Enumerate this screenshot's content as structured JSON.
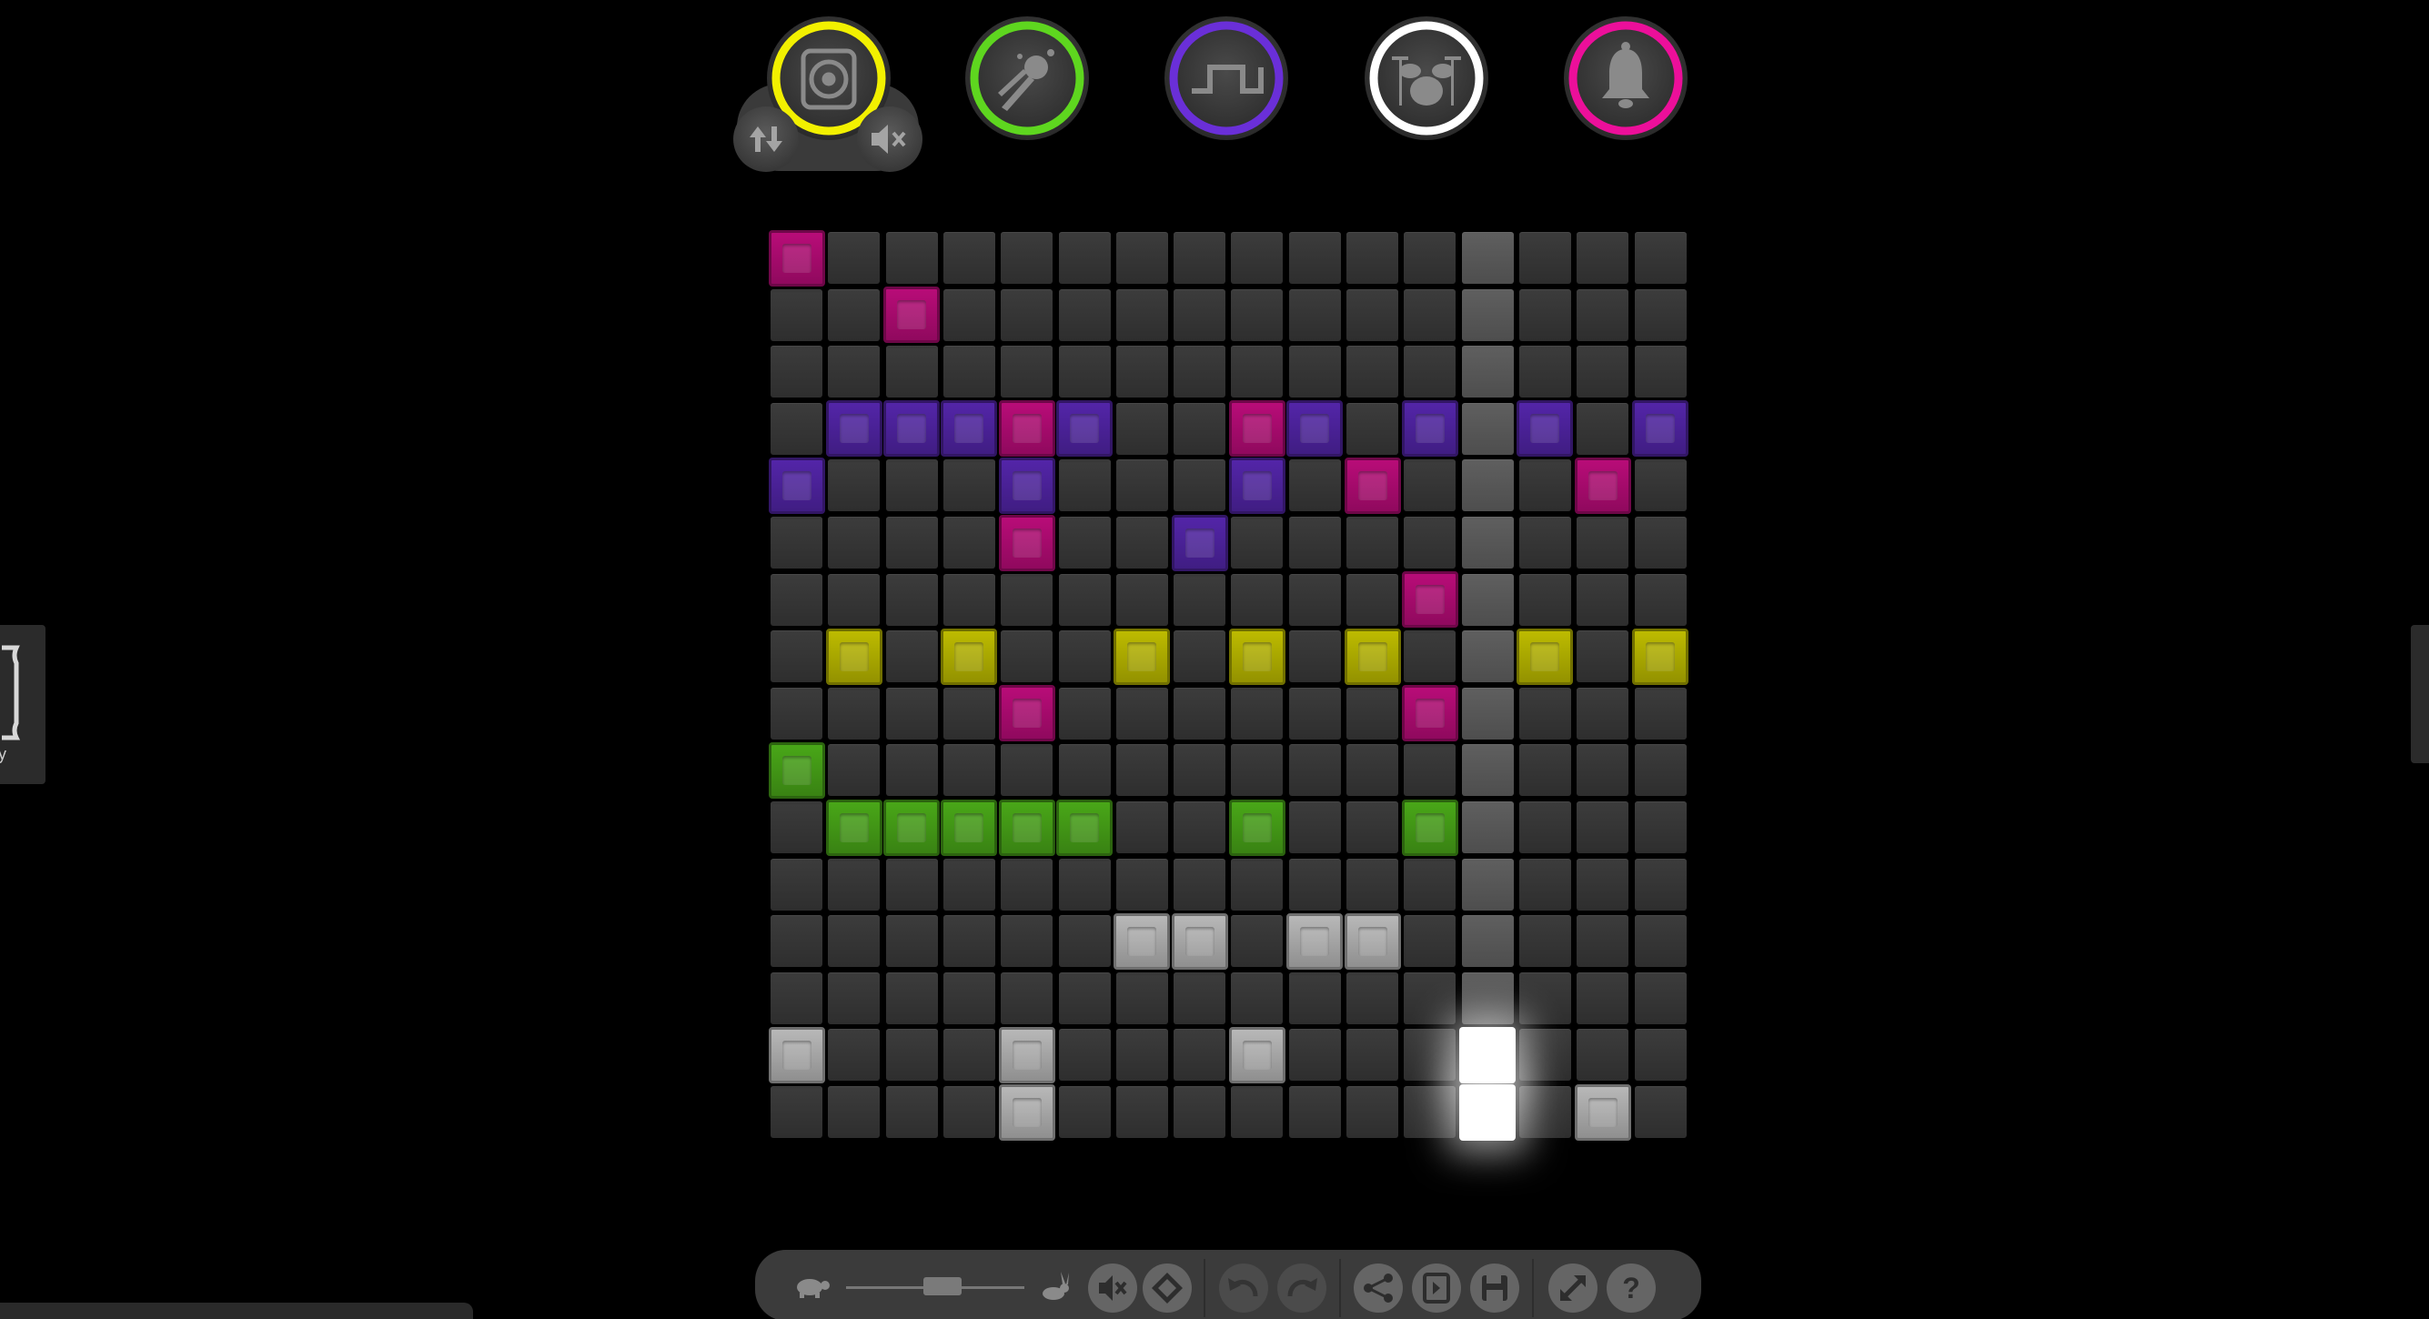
{
  "side_panel_left": {
    "label": "y",
    "icon": "frame-icon"
  },
  "instruments": [
    {
      "name": "speaker",
      "icon": "speaker-icon",
      "color": "#f2f000",
      "selected": true
    },
    {
      "name": "synth-lead",
      "icon": "comet-icon",
      "color": "#5ed61f"
    },
    {
      "name": "square-wave",
      "icon": "square-wave-icon",
      "color": "#6a2fd8"
    },
    {
      "name": "drums",
      "icon": "drum-kit-icon",
      "color": "#ffffff"
    },
    {
      "name": "bell",
      "icon": "bell-icon",
      "color": "#ec0f9a"
    }
  ],
  "instrument_tools": [
    {
      "name": "octave-toggle",
      "icon": "up-down-arrows-icon"
    },
    {
      "name": "mute-instrument",
      "icon": "speaker-mute-icon"
    }
  ],
  "grid": {
    "rows": 16,
    "cols": 16,
    "highlight_column": 12,
    "notes": [
      {
        "row": 0,
        "col": 0,
        "color": "#ec0f9a"
      },
      {
        "row": 1,
        "col": 2,
        "color": "#ec0f9a"
      },
      {
        "row": 3,
        "col": 1,
        "color": "#6a2fd8"
      },
      {
        "row": 3,
        "col": 2,
        "color": "#6a2fd8"
      },
      {
        "row": 3,
        "col": 3,
        "color": "#6a2fd8"
      },
      {
        "row": 3,
        "col": 4,
        "color": "#ec0f9a"
      },
      {
        "row": 3,
        "col": 5,
        "color": "#6a2fd8"
      },
      {
        "row": 3,
        "col": 8,
        "color": "#ec0f9a"
      },
      {
        "row": 3,
        "col": 9,
        "color": "#6a2fd8"
      },
      {
        "row": 3,
        "col": 11,
        "color": "#6a2fd8"
      },
      {
        "row": 3,
        "col": 13,
        "color": "#6a2fd8"
      },
      {
        "row": 3,
        "col": 15,
        "color": "#6a2fd8"
      },
      {
        "row": 4,
        "col": 0,
        "color": "#6a2fd8"
      },
      {
        "row": 4,
        "col": 4,
        "color": "#6a2fd8"
      },
      {
        "row": 4,
        "col": 8,
        "color": "#6a2fd8"
      },
      {
        "row": 4,
        "col": 10,
        "color": "#ec0f9a"
      },
      {
        "row": 4,
        "col": 14,
        "color": "#ec0f9a"
      },
      {
        "row": 5,
        "col": 4,
        "color": "#ec0f9a"
      },
      {
        "row": 5,
        "col": 7,
        "color": "#6a2fd8"
      },
      {
        "row": 6,
        "col": 11,
        "color": "#ec0f9a"
      },
      {
        "row": 7,
        "col": 1,
        "color": "#f2f000"
      },
      {
        "row": 7,
        "col": 3,
        "color": "#f2f000"
      },
      {
        "row": 7,
        "col": 6,
        "color": "#f2f000"
      },
      {
        "row": 7,
        "col": 8,
        "color": "#f2f000"
      },
      {
        "row": 7,
        "col": 10,
        "color": "#f2f000"
      },
      {
        "row": 7,
        "col": 13,
        "color": "#f2f000"
      },
      {
        "row": 7,
        "col": 15,
        "color": "#f2f000"
      },
      {
        "row": 8,
        "col": 4,
        "color": "#ec0f9a"
      },
      {
        "row": 8,
        "col": 11,
        "color": "#ec0f9a"
      },
      {
        "row": 9,
        "col": 0,
        "color": "#5ed61f"
      },
      {
        "row": 10,
        "col": 1,
        "color": "#5ed61f"
      },
      {
        "row": 10,
        "col": 2,
        "color": "#5ed61f"
      },
      {
        "row": 10,
        "col": 3,
        "color": "#5ed61f"
      },
      {
        "row": 10,
        "col": 4,
        "color": "#5ed61f"
      },
      {
        "row": 10,
        "col": 5,
        "color": "#5ed61f"
      },
      {
        "row": 10,
        "col": 8,
        "color": "#5ed61f"
      },
      {
        "row": 10,
        "col": 11,
        "color": "#5ed61f"
      },
      {
        "row": 12,
        "col": 6,
        "color": "#ffffff"
      },
      {
        "row": 12,
        "col": 7,
        "color": "#ffffff"
      },
      {
        "row": 12,
        "col": 9,
        "color": "#ffffff"
      },
      {
        "row": 12,
        "col": 10,
        "color": "#ffffff"
      },
      {
        "row": 14,
        "col": 0,
        "color": "#ffffff"
      },
      {
        "row": 14,
        "col": 4,
        "color": "#ffffff"
      },
      {
        "row": 14,
        "col": 8,
        "color": "#ffffff"
      },
      {
        "row": 14,
        "col": 12,
        "color": "#ffffff",
        "playing": true
      },
      {
        "row": 15,
        "col": 4,
        "color": "#ffffff"
      },
      {
        "row": 15,
        "col": 12,
        "color": "#ffffff",
        "playing": true
      },
      {
        "row": 15,
        "col": 14,
        "color": "#ffffff"
      }
    ]
  },
  "toolbar": {
    "tempo": {
      "slow_icon": "turtle-icon",
      "fast_icon": "rabbit-icon",
      "value": 0.5
    },
    "buttons": [
      {
        "name": "mute-all",
        "icon": "speaker-mute-icon"
      },
      {
        "name": "clear",
        "icon": "eraser-icon"
      },
      {
        "name": "undo",
        "icon": "undo-icon",
        "disabled": true
      },
      {
        "name": "redo",
        "icon": "redo-icon",
        "disabled": true
      },
      {
        "name": "share",
        "icon": "share-icon"
      },
      {
        "name": "export",
        "icon": "export-icon"
      },
      {
        "name": "save",
        "icon": "save-icon"
      },
      {
        "name": "fullscreen",
        "icon": "expand-icon"
      },
      {
        "name": "help",
        "icon": "help-icon",
        "glyph": "?"
      }
    ]
  }
}
